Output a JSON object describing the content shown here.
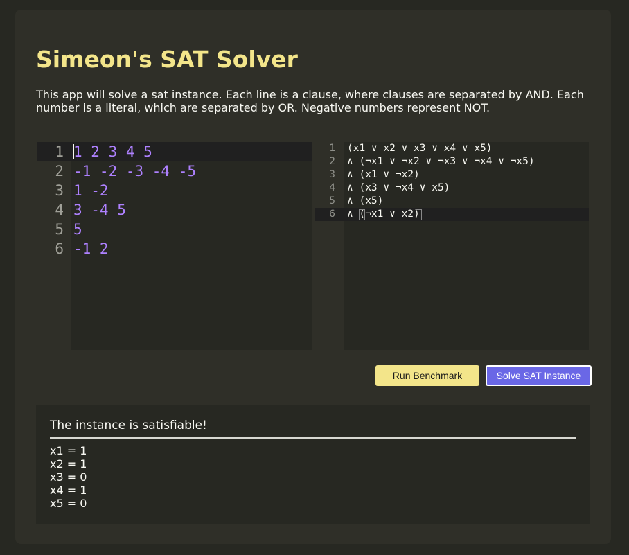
{
  "title": "Simeon's SAT Solver",
  "description": "This app will solve a sat instance. Each line is a clause, where clauses are separated by AND. Each number is a literal, which are separated by OR. Negative numbers represent NOT.",
  "input_editor": {
    "line_numbers": [
      "1",
      "2",
      "3",
      "4",
      "5",
      "6"
    ],
    "lines": [
      "1 2 3 4 5",
      "-1 -2 -3 -4 -5",
      "1 -2",
      "3 -4 5",
      "5",
      "-1 2"
    ]
  },
  "formula_editor": {
    "line_numbers": [
      "1",
      "2",
      "3",
      "4",
      "5",
      "6"
    ],
    "lines": [
      "(x1 ∨ x2 ∨ x3 ∨ x4 ∨ x5)",
      "∧ (¬x1 ∨ ¬x2 ∨ ¬x3 ∨ ¬x4 ∨ ¬x5)",
      "∧ (x1 ∨ ¬x2)",
      "∧ (x3 ∨ ¬x4 ∨ x5)",
      "∧ (x5)",
      "∧ (¬x1 ∨ x2)"
    ]
  },
  "buttons": {
    "benchmark_label": "Run Benchmark",
    "solve_label": "Solve SAT Instance"
  },
  "result": {
    "message": "The instance is satisfiable!",
    "assignments": [
      "x1 = 1",
      "x2 = 1",
      "x3 = 0",
      "x4 = 1",
      "x5 = 0"
    ]
  },
  "colors": {
    "accent_yellow": "#f3e58a",
    "accent_purple": "#6a67e6",
    "literal_purple": "#ae81ff",
    "background": "#272822"
  }
}
